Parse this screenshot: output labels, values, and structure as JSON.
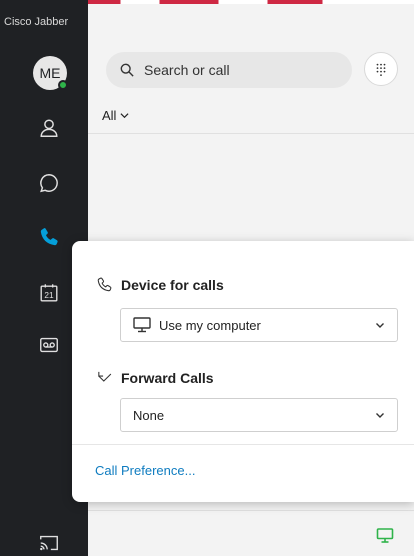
{
  "app": {
    "title": "Cisco Jabber"
  },
  "user": {
    "initials": "ME",
    "presence_color": "#2fb34a"
  },
  "sidebar": {
    "items": [
      {
        "name": "contacts",
        "icon": "person-icon"
      },
      {
        "name": "chats",
        "icon": "chat-bubble-icon"
      },
      {
        "name": "calls",
        "icon": "phone-icon",
        "active": true
      },
      {
        "name": "meetings",
        "icon": "calendar-icon",
        "day": "21"
      },
      {
        "name": "voicemail",
        "icon": "voicemail-icon"
      },
      {
        "name": "cast",
        "icon": "screen-cast-icon"
      }
    ],
    "active_color": "#049fd9"
  },
  "search": {
    "placeholder": "Search or call"
  },
  "filter": {
    "label": "All"
  },
  "popover": {
    "device_title": "Device for calls",
    "device_value": "Use my computer",
    "forward_title": "Forward Calls",
    "forward_value": "None",
    "link_label": "Call Preference..."
  },
  "colors": {
    "link": "#0f7cc0",
    "sidebar_bg": "#1f2124",
    "device_status": "#2fb34a"
  }
}
